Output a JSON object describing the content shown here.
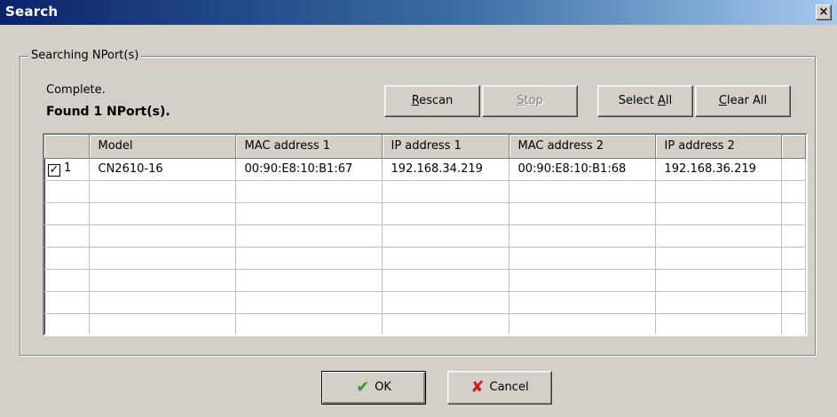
{
  "window": {
    "title": "Search",
    "close_glyph": "×"
  },
  "group": {
    "label": "Searching NPort(s)"
  },
  "status": {
    "text": "Complete.",
    "found": "Found 1 NPort(s)."
  },
  "buttons": {
    "rescan": {
      "pre": "",
      "key": "R",
      "post": "escan"
    },
    "stop": {
      "pre": "",
      "key": "S",
      "post": "top"
    },
    "select_all": {
      "pre": "Select ",
      "key": "A",
      "post": "ll"
    },
    "clear_all": {
      "pre": "",
      "key": "C",
      "post": "lear All"
    },
    "ok": {
      "label": "OK",
      "icon": "checkmark-icon"
    },
    "cancel": {
      "label": "Cancel",
      "icon": "x-cross-icon"
    }
  },
  "table": {
    "headers": [
      "",
      "Model",
      "MAC address 1",
      "IP address 1",
      "MAC address 2",
      "IP address 2"
    ],
    "rows": [
      {
        "checked": true,
        "index": "1",
        "model": "CN2610-16",
        "mac1": "00:90:E8:10:B1:67",
        "ip1": "192.168.34.219",
        "mac2": "00:90:E8:10:B1:68",
        "ip2": "192.168.36.219"
      }
    ],
    "empty_row_count": 7
  },
  "colors": {
    "face": "#d4d0c8",
    "title_start": "#0a246a",
    "title_end": "#a6caf0",
    "ok_icon": "#2e9b2e",
    "cancel_icon": "#c81c1c"
  }
}
